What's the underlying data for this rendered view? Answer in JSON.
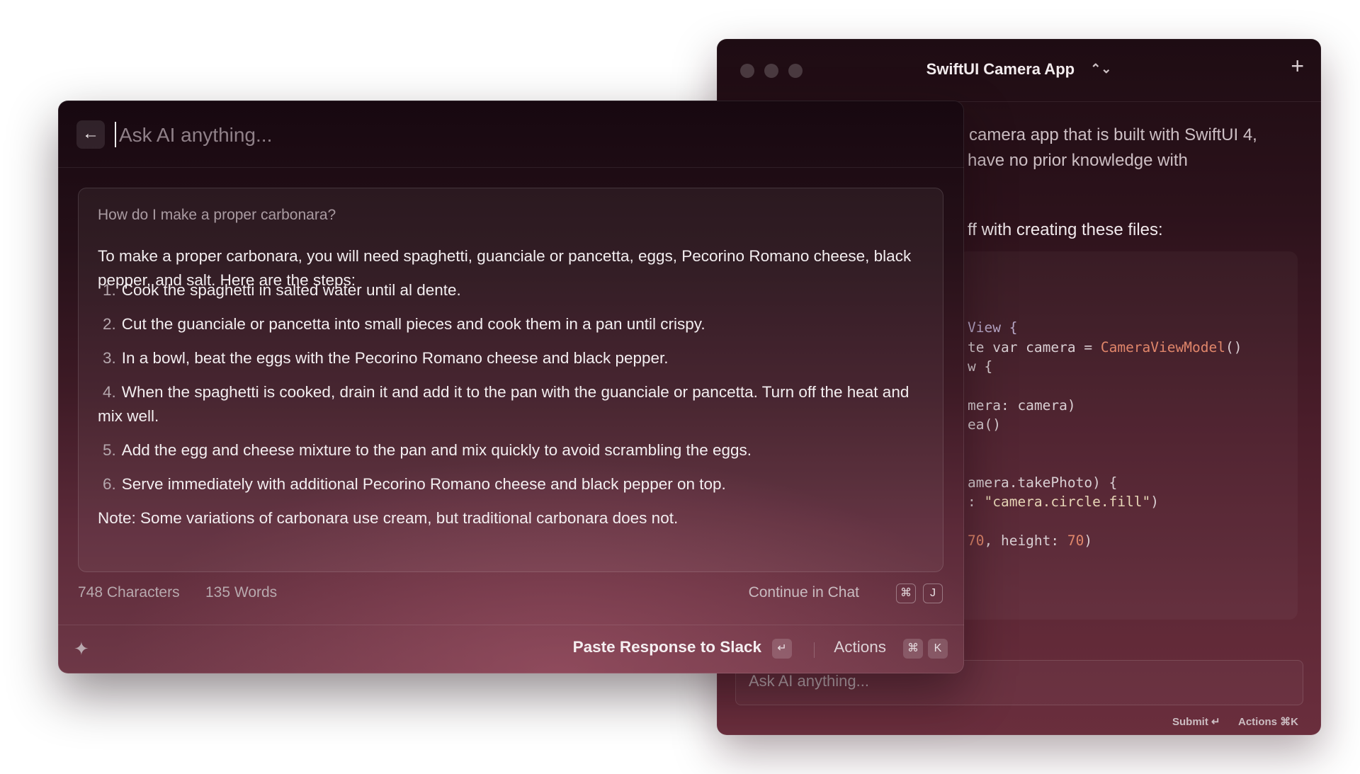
{
  "back_window": {
    "title": "SwiftUI Camera App",
    "title_chevron": "⌃⌄",
    "new_button": "+",
    "partial_text_1": "camera app that is built with SwiftUI 4,",
    "partial_text_2": "have no prior knowledge with",
    "partial_heading": "ff with creating these files:",
    "code": {
      "l1_a": "View {",
      "l2_a": "te var camera = ",
      "l2_b": "CameraViewModel",
      "l2_c": "()",
      "l3_a": "w {",
      "l4_a": "mera: camera)",
      "l5_a": "ea()",
      "l6_a": "amera.takePhoto) {",
      "l7_a": ": ",
      "l7_b": "\"camera.circle.fill\"",
      "l7_c": ")",
      "l8_a": "70",
      "l8_b": ", height: ",
      "l8_c": "70",
      "l8_d": ")"
    },
    "input_placeholder": "Ask AI anything...",
    "submit_label": "Submit ↵",
    "actions_label": "Actions ⌘K"
  },
  "front_window": {
    "back_icon": "←",
    "input_placeholder": "Ask AI anything...",
    "question": "How do I make a proper carbonara?",
    "answer_intro": "To make a proper carbonara, you will need spaghetti, guanciale or pancetta, eggs, Pecorino Romano cheese, black pepper, and salt. Here are the steps:",
    "steps": [
      {
        "num": "1.",
        "text": "Cook the spaghetti in salted water until al dente."
      },
      {
        "num": "2.",
        "text": "Cut the guanciale or pancetta into small pieces and cook them in a pan until crispy."
      },
      {
        "num": "3.",
        "text": "In a bowl, beat the eggs with the Pecorino Romano cheese and black pepper."
      },
      {
        "num": "4.",
        "text": "When the spaghetti is cooked, drain it and add it to the pan with the guanciale or pancetta. Turn off the heat and mix well."
      },
      {
        "num": "5.",
        "text": "Add the egg and cheese mixture to the pan and mix quickly to avoid scrambling the eggs."
      },
      {
        "num": "6.",
        "text": "Serve immediately with additional Pecorino Romano cheese and black pepper on top."
      }
    ],
    "note": "Note: Some variations of carbonara use cream, but traditional carbonara does not.",
    "char_count": "748 Characters",
    "word_count": "135 Words",
    "continue_label": "Continue in Chat",
    "continue_keys": [
      "⌘",
      "J"
    ],
    "paste_label": "Paste Response to Slack",
    "paste_key": "↵",
    "actions_label": "Actions",
    "actions_keys": [
      "⌘",
      "K"
    ],
    "sparkle_icon": "✦"
  }
}
